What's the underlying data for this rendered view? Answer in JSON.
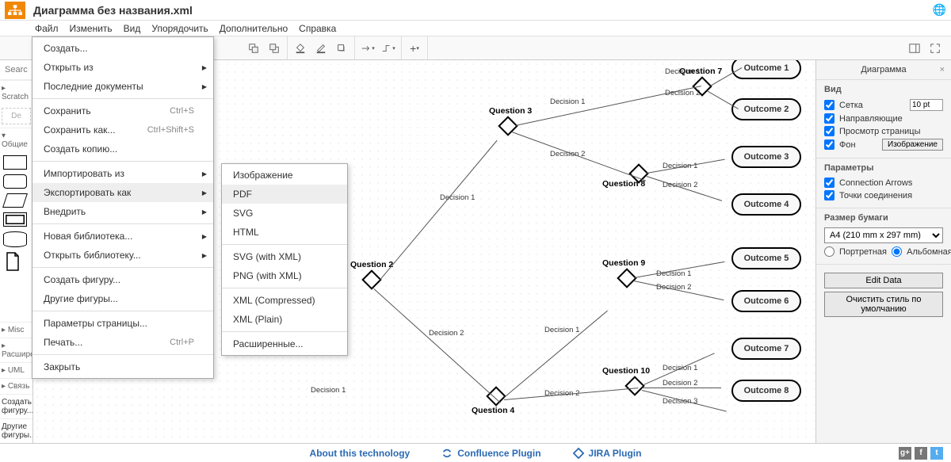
{
  "header": {
    "title": "Диаграмма без названия.xml"
  },
  "menubar": [
    "Файл",
    "Изменить",
    "Вид",
    "Упорядочить",
    "Дополнительно",
    "Справка"
  ],
  "file_menu": {
    "create": "Создать...",
    "open_from": "Открыть из",
    "recent": "Последние документы",
    "save": "Сохранить",
    "save_sc": "Ctrl+S",
    "save_as": "Сохранить как...",
    "save_as_sc": "Ctrl+Shift+S",
    "make_copy": "Создать копию...",
    "import_from": "Импортировать из",
    "export_as": "Экспортировать как",
    "embed": "Внедрить",
    "new_lib": "Новая библиотека...",
    "open_lib": "Открыть библиотеку...",
    "create_shape": "Создать фигуру...",
    "more_shapes": "Другие фигуры...",
    "page_setup": "Параметры страницы...",
    "print": "Печать...",
    "print_sc": "Ctrl+P",
    "close": "Закрыть"
  },
  "export_menu": [
    "Изображение",
    "PDF",
    "SVG",
    "HTML",
    "SVG (with XML)",
    "PNG (with XML)",
    "XML (Compressed)",
    "XML (Plain)",
    "Расширенные..."
  ],
  "left_panel": {
    "search_ph": "Searc",
    "scratch": "Scratch",
    "de": "De",
    "general": "Общие",
    "misc": "Misc",
    "ext": "Расширенные",
    "uml": "UML",
    "rel": "Связь между объектами",
    "create": "Создать фигуру...",
    "more": "Другие фигуры..."
  },
  "right_panel": {
    "title": "Диаграмма",
    "view": "Вид",
    "grid": "Сетка",
    "grid_val": "10 pt",
    "guides": "Направляющие",
    "page_view": "Просмотр страницы",
    "bg": "Фон",
    "bg_val": "Изображение",
    "params": "Параметры",
    "conn_arrows": "Connection Arrows",
    "conn_points": "Точки соединения",
    "paper_size": "Размер бумаги",
    "paper_val": "A4 (210 mm x 297 mm)",
    "portrait": "Портретная",
    "landscape": "Альбомная",
    "edit_data": "Edit Data",
    "clear_style": "Очистить стиль по умолчанию"
  },
  "footer": {
    "about": "About this technology",
    "conf": "Confluence Plugin",
    "jira": "JIRA Plugin"
  },
  "diagram": {
    "questions": {
      "q2": "Question 2",
      "q3": "Question 3",
      "q4": "Question 4",
      "q7": "Question 7",
      "q8": "Question 8",
      "q9": "Question 9",
      "q10": "Question 10"
    },
    "outcomes": {
      "o1": "Outcome 1",
      "o2": "Outcome 2",
      "o3": "Outcome 3",
      "o4": "Outcome 4",
      "o5": "Outcome 5",
      "o6": "Outcome 6",
      "o7": "Outcome 7",
      "o8": "Outcome 8"
    },
    "edges": {
      "d1": "Decision 1",
      "d2": "Decision 2",
      "d3": "Decision 3"
    }
  }
}
